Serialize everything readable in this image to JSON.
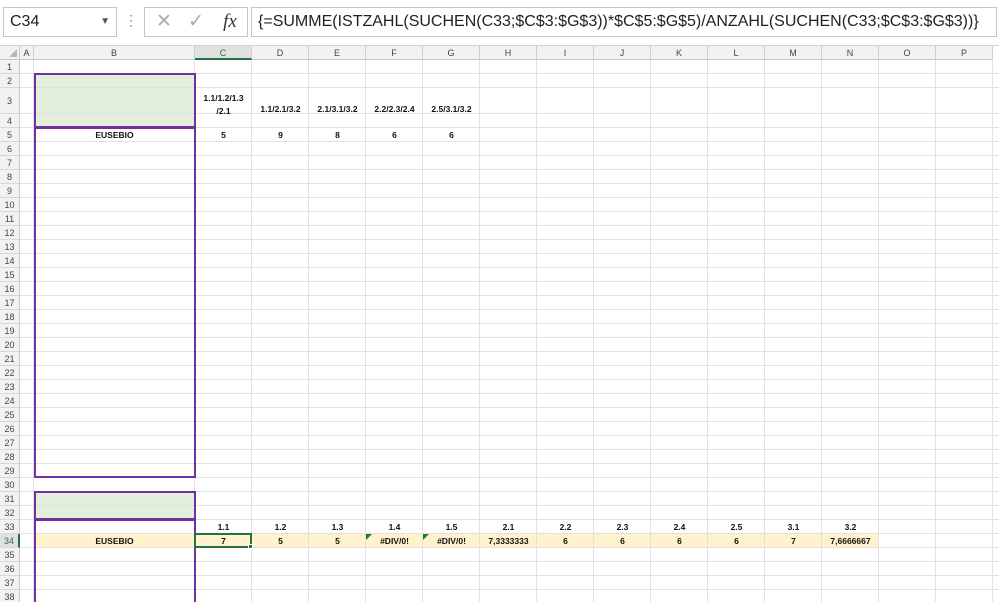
{
  "formula_bar": {
    "name_box": "C34",
    "dots": "⋮",
    "cancel_glyph": "✕",
    "enter_glyph": "✓",
    "fx_label": "fx",
    "formula": "{=SUMME(ISTZAHL(SUCHEN(C33;$C$3:$G$3))*$C$5:$G$5)/ANZAHL(SUCHEN(C33;$C$3:$G$3))}"
  },
  "columns": [
    "A",
    "B",
    "C",
    "D",
    "E",
    "F",
    "G",
    "H",
    "I",
    "J",
    "K",
    "L",
    "M",
    "N",
    "O",
    "P"
  ],
  "rows": [
    "1",
    "2",
    "3",
    "4",
    "5",
    "6",
    "7",
    "8",
    "9",
    "10",
    "11",
    "12",
    "13",
    "14",
    "15",
    "16",
    "17",
    "18",
    "19",
    "20",
    "21",
    "22",
    "23",
    "24",
    "25",
    "26",
    "27",
    "28",
    "29",
    "30",
    "31",
    "32",
    "33",
    "34",
    "35",
    "36",
    "37",
    "38"
  ],
  "active_cell": "C34",
  "block1": {
    "headers": [
      [
        "1.1/1.2/1.3",
        "/2.1"
      ],
      [
        "1.1/2.1/3.2"
      ],
      [
        "2.1/3.1/3.2"
      ],
      [
        "2.2/2.3/2.4"
      ],
      [
        "2.5/3.1/3.2"
      ]
    ],
    "name": "EUSEBIO",
    "values": [
      "5",
      "9",
      "8",
      "6",
      "6"
    ]
  },
  "block2": {
    "headers": [
      "1.1",
      "1.2",
      "1.3",
      "1.4",
      "1.5",
      "2.1",
      "2.2",
      "2.3",
      "2.4",
      "2.5",
      "3.1",
      "3.2"
    ],
    "name": "EUSEBIO",
    "values": [
      "7",
      "5",
      "5",
      "#DIV/0!",
      "#DIV/0!",
      "7,3333333",
      "6",
      "6",
      "6",
      "6",
      "7",
      "7,6666667"
    ]
  },
  "colors": {
    "header_fill": "#e2efda",
    "row34_fill": "#fff2cc",
    "box_border": "#7030a0",
    "selection": "#217346"
  }
}
